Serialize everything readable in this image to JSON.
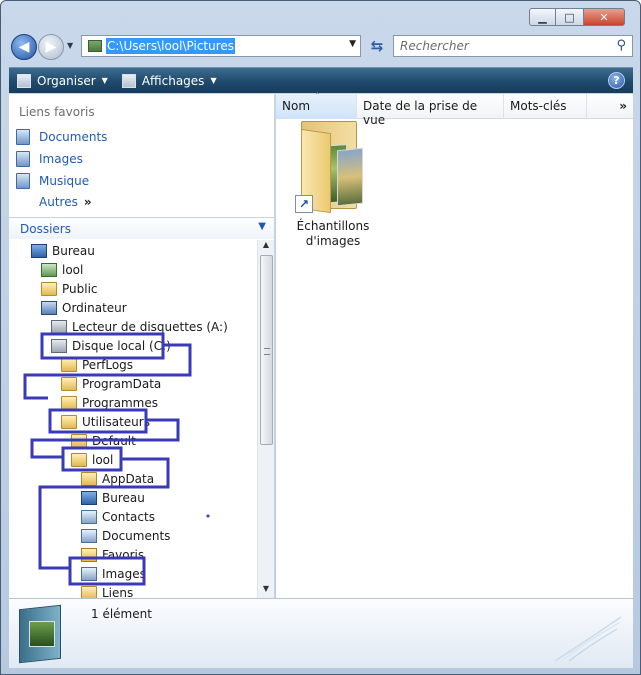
{
  "window": {
    "caption_min": "▁",
    "caption_max": "□",
    "caption_close": "✕"
  },
  "nav": {
    "back_icon": "arrow-left-icon",
    "forward_icon": "arrow-right-icon",
    "address": "C:\\Users\\lool\\Pictures",
    "search_placeholder": "Rechercher"
  },
  "toolbar": {
    "organize": "Organiser",
    "views": "Affichages",
    "help": "?"
  },
  "favorites": {
    "title": "Liens favoris",
    "items": [
      "Documents",
      "Images",
      "Musique"
    ],
    "more": "Autres",
    "more_arrows": "»"
  },
  "folders": {
    "title": "Dossiers",
    "tree": [
      {
        "label": "Bureau",
        "icon": "desktop"
      },
      {
        "label": "lool",
        "icon": "user"
      },
      {
        "label": "Public",
        "icon": "folder"
      },
      {
        "label": "Ordinateur",
        "icon": "computer"
      },
      {
        "label": "Lecteur de disquettes (A:)",
        "icon": "drive"
      },
      {
        "label": "Disque local (C:)",
        "icon": "drive"
      },
      {
        "label": "PerfLogs",
        "icon": "folder"
      },
      {
        "label": "ProgramData",
        "icon": "folder"
      },
      {
        "label": "Programmes",
        "icon": "folder"
      },
      {
        "label": "Utilisateurs",
        "icon": "folder"
      },
      {
        "label": "Default",
        "icon": "folder"
      },
      {
        "label": "lool",
        "icon": "folder"
      },
      {
        "label": "AppData",
        "icon": "folder"
      },
      {
        "label": "Bureau",
        "icon": "desktop"
      },
      {
        "label": "Contacts",
        "icon": "doc"
      },
      {
        "label": "Documents",
        "icon": "doc"
      },
      {
        "label": "Favoris",
        "icon": "star"
      },
      {
        "label": "Images",
        "icon": "doc"
      },
      {
        "label": "Liens",
        "icon": "folder"
      }
    ]
  },
  "columns": [
    "Nom",
    "Date de la prise de vue",
    "Mots-clés"
  ],
  "columns_more": "»",
  "files": [
    {
      "name_line1": "Échantillons",
      "name_line2": "d'images"
    }
  ],
  "status": {
    "count": "1 élément"
  },
  "colors": {
    "toolbar": "#1f4a6d",
    "link": "#1f5bb3",
    "annotation": "#3a3ab8",
    "selection": "#3399ff"
  }
}
